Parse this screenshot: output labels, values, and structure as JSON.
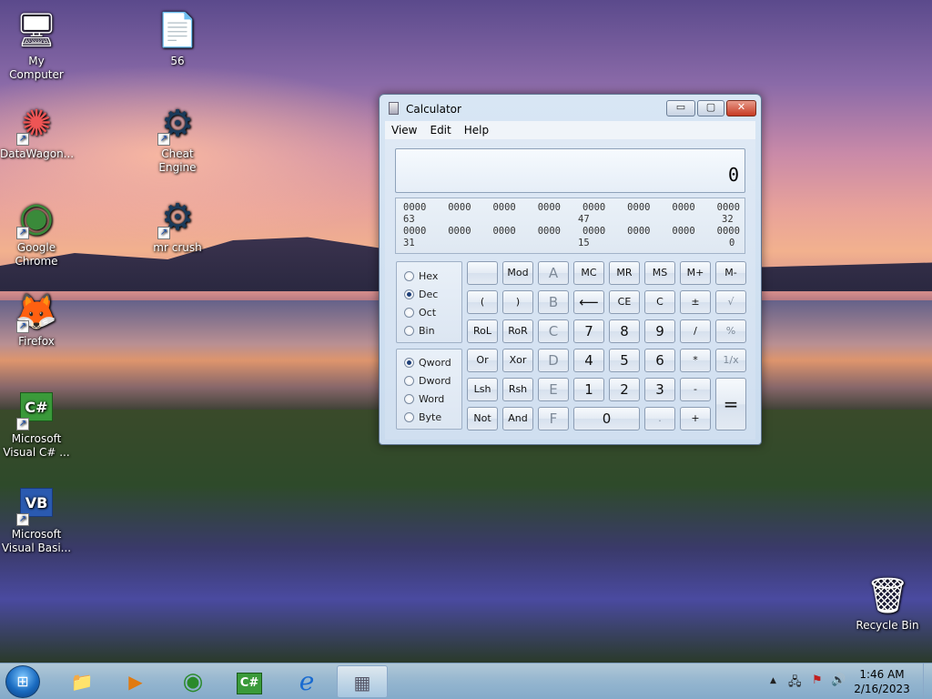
{
  "desktop": {
    "icons": [
      {
        "label": "My Computer",
        "glyph": "🖥"
      },
      {
        "label": "56",
        "glyph": "📄"
      },
      {
        "label": "DataWagon...",
        "glyph": "✺"
      },
      {
        "label": "Cheat Engine",
        "glyph": "⚙"
      },
      {
        "label": "Google Chrome",
        "glyph": "◉"
      },
      {
        "label": "mr crush",
        "glyph": "⚙"
      },
      {
        "label": "Firefox",
        "glyph": "🦊"
      },
      {
        "label": "Microsoft Visual C# ...",
        "glyph": "C#"
      },
      {
        "label": "Microsoft Visual Basi...",
        "glyph": "VB"
      },
      {
        "label": "Recycle Bin",
        "glyph": "🗑"
      }
    ],
    "shortcut_arrow": "↗"
  },
  "calculator": {
    "title": "Calculator",
    "window_buttons": {
      "minimize": "▭",
      "maximize": "▢",
      "close": "✕"
    },
    "menu": [
      "View",
      "Edit",
      "Help"
    ],
    "display_value": "0",
    "bits": {
      "row1": [
        "0000",
        "0000",
        "0000",
        "0000",
        "0000",
        "0000",
        "0000",
        "0000"
      ],
      "row1_labels": {
        "left": "63",
        "mid": "47",
        "right": "32"
      },
      "row2": [
        "0000",
        "0000",
        "0000",
        "0000",
        "0000",
        "0000",
        "0000",
        "0000"
      ],
      "row2_labels": {
        "left": "31",
        "mid": "15",
        "right": "0"
      }
    },
    "radix": [
      {
        "label": "Hex",
        "checked": false
      },
      {
        "label": "Dec",
        "checked": true
      },
      {
        "label": "Oct",
        "checked": false
      },
      {
        "label": "Bin",
        "checked": false
      }
    ],
    "word_size": [
      {
        "label": "Qword",
        "checked": true
      },
      {
        "label": "Dword",
        "checked": false
      },
      {
        "label": "Word",
        "checked": false
      },
      {
        "label": "Byte",
        "checked": false
      }
    ],
    "keys": {
      "blank": "",
      "mod": "Mod",
      "a": "A",
      "mc": "MC",
      "mr": "MR",
      "ms": "MS",
      "mplus": "M+",
      "mminus": "M-",
      "lparen": "(",
      "rparen": ")",
      "b": "B",
      "backspace": "⟵",
      "ce": "CE",
      "c": "C",
      "plusminus": "±",
      "sqrt": "√",
      "rol": "RoL",
      "ror": "RoR",
      "cc": "C",
      "seven": "7",
      "eight": "8",
      "nine": "9",
      "divide": "/",
      "percent": "%",
      "or": "Or",
      "xor": "Xor",
      "d": "D",
      "four": "4",
      "five": "5",
      "six": "6",
      "multiply": "*",
      "reciprocal": "1/x",
      "lsh": "Lsh",
      "rsh": "Rsh",
      "e": "E",
      "one": "1",
      "two": "2",
      "three": "3",
      "minus": "-",
      "equals": "=",
      "not": "Not",
      "and": "And",
      "f": "F",
      "zero": "0",
      "decimal": ".",
      "plus": "+"
    }
  },
  "taskbar": {
    "start_glyph": "⊞",
    "items": [
      {
        "name": "explorer",
        "glyph": "📁"
      },
      {
        "name": "media-player",
        "glyph": "▶"
      },
      {
        "name": "chrome",
        "glyph": "◉"
      },
      {
        "name": "visual-csharp",
        "glyph": "C#"
      },
      {
        "name": "internet-explorer",
        "glyph": "e"
      },
      {
        "name": "calculator",
        "glyph": "▦"
      }
    ],
    "tray": {
      "up": "▲",
      "network": "🖧",
      "flag": "⚑",
      "volume": "🔊"
    },
    "time": "1:46 AM",
    "date": "2/16/2023"
  }
}
